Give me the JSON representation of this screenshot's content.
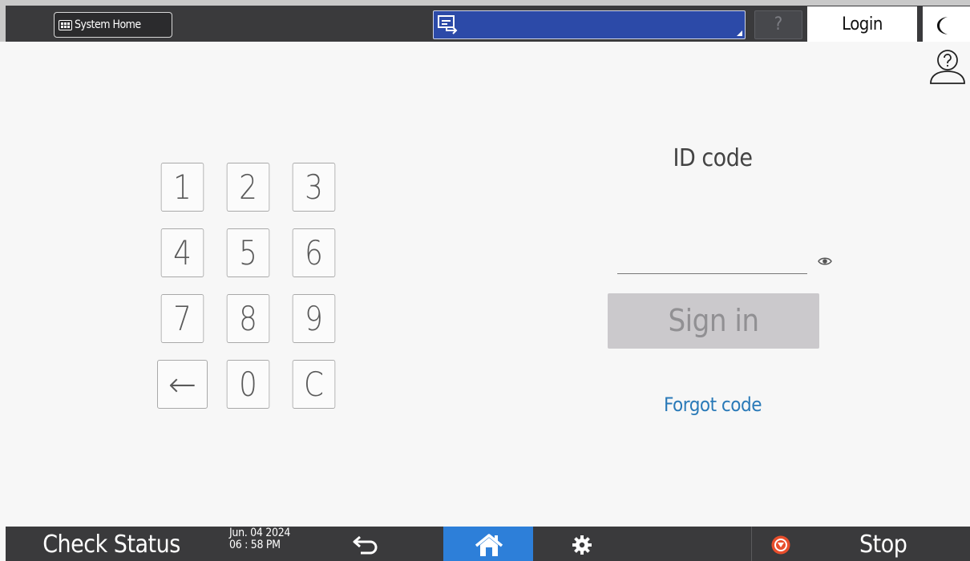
{
  "header": {
    "system_home_label": "System Home",
    "help_label": "?",
    "login_label": "Login"
  },
  "keypad": {
    "keys": [
      "1",
      "2",
      "3",
      "4",
      "5",
      "6",
      "7",
      "8",
      "9",
      "←",
      "0",
      "C"
    ]
  },
  "login_form": {
    "id_label": "ID code",
    "id_value": "",
    "signin_label": "Sign in",
    "forgot_label": "Forgot code"
  },
  "footer": {
    "check_status_label": "Check Status",
    "date": "Jun. 04 2024",
    "time": "06 : 58 PM",
    "stop_label": "Stop"
  },
  "colors": {
    "top_bar": "#3a3a3c",
    "app_select": "#2c4aa8",
    "home_active": "#2d7fd9",
    "signin_disabled": "#cbc9cc",
    "link": "#2a7ab8",
    "stop_icon": "#e84e2c"
  },
  "icons": {
    "system_home": "grid-icon",
    "app_select": "screen-switch-icon",
    "sleep": "moon-icon",
    "user_help": "user-help-icon",
    "show_code": "eye-icon",
    "back": "back-arrow-icon",
    "home": "home-icon",
    "settings": "gear-icon",
    "stop": "stop-icon"
  }
}
